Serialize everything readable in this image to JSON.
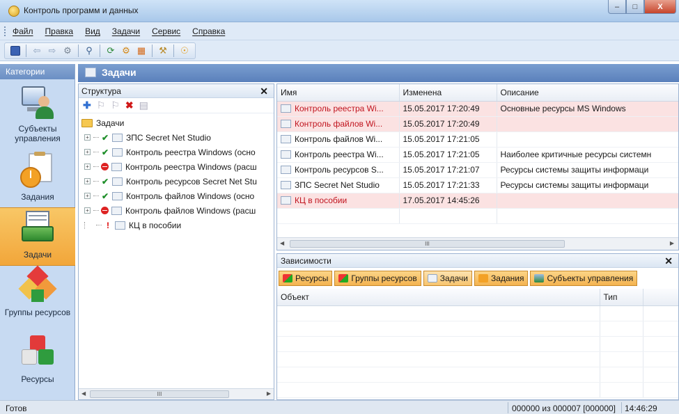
{
  "window": {
    "title": "Контроль программ и данных"
  },
  "menu": [
    "Файл",
    "Правка",
    "Вид",
    "Задачи",
    "Сервис",
    "Справка"
  ],
  "toolbar_icons": [
    "save-icon",
    "back-arrow-icon",
    "forward-arrow-icon",
    "home-icon",
    "search-icon",
    "refresh-icon",
    "settings-icon",
    "calculator-icon",
    "tools-icon",
    "help-icon"
  ],
  "sidebar": {
    "header": "Категории",
    "items": [
      {
        "label": "Субъекты управления",
        "icon": "users-icon",
        "active": false
      },
      {
        "label": "Задания",
        "icon": "clock-task-icon",
        "active": false
      },
      {
        "label": "Задачи",
        "icon": "tasks-icon",
        "active": true
      },
      {
        "label": "Группы ресурсов",
        "icon": "resource-groups-icon",
        "active": false
      },
      {
        "label": "Ресурсы",
        "icon": "resources-icon",
        "active": false
      }
    ]
  },
  "main": {
    "title": "Задачи"
  },
  "structure": {
    "title": "Структура",
    "root": "Задачи",
    "items": [
      {
        "label": "ЗПС Secret Net Studio",
        "status": "ok"
      },
      {
        "label": "Контроль реестра Windows (осно",
        "status": "ok"
      },
      {
        "label": "Контроль реестра Windows (расш",
        "status": "stop"
      },
      {
        "label": "Контроль ресурсов Secret Net Stu",
        "status": "ok"
      },
      {
        "label": "Контроль файлов Windows (осно",
        "status": "ok"
      },
      {
        "label": "Контроль файлов Windows (расш",
        "status": "stop"
      },
      {
        "label": "КЦ в пособии",
        "status": "warning"
      }
    ]
  },
  "tasks_table": {
    "columns": [
      "Имя",
      "Изменена",
      "Описание"
    ],
    "rows": [
      {
        "name": "Контроль реестра Wi...",
        "modified": "15.05.2017 17:20:49",
        "description": "Основные ресурсы MS Windows",
        "highlight": true
      },
      {
        "name": "Контроль файлов Wi...",
        "modified": "15.05.2017 17:20:49",
        "description": "",
        "highlight": true
      },
      {
        "name": "Контроль файлов Wi...",
        "modified": "15.05.2017 17:21:05",
        "description": "",
        "highlight": false
      },
      {
        "name": "Контроль реестра Wi...",
        "modified": "15.05.2017 17:21:05",
        "description": "Наиболее критичные ресурсы системн",
        "highlight": false
      },
      {
        "name": "Контроль ресурсов S...",
        "modified": "15.05.2017 17:21:07",
        "description": "Ресурсы системы защиты информаци",
        "highlight": false
      },
      {
        "name": "ЗПС Secret Net Studio",
        "modified": "15.05.2017 17:21:33",
        "description": "Ресурсы системы защиты информаци",
        "highlight": false
      },
      {
        "name": "КЦ в пособии",
        "modified": "17.05.2017 14:45:26",
        "description": "",
        "highlight": true
      }
    ]
  },
  "dependencies": {
    "title": "Зависимости",
    "tabs": [
      "Ресурсы",
      "Группы ресурсов",
      "Задачи",
      "Задания",
      "Субъекты управления"
    ],
    "columns": [
      "Объект",
      "Тип"
    ]
  },
  "status": {
    "text": "Готов",
    "counts": "000000 из 000007 [000000]",
    "time": "14:46:29"
  },
  "scrollbar_grip": "III"
}
